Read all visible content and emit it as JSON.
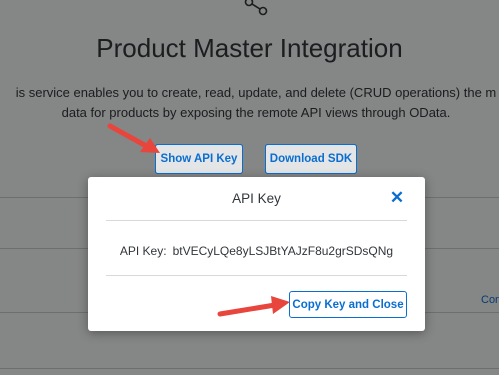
{
  "page": {
    "title": "Product Master Integration",
    "description_line1": "is service enables you to create, read, update, and delete (CRUD operations) the m",
    "description_line2": "data for products by exposing the remote API views through OData.",
    "show_api_key_label": "Show API Key",
    "download_sdk_label": "Download SDK",
    "right_link_partial": "Con"
  },
  "dialog": {
    "title": "API Key",
    "close_symbol": "✕",
    "key_label": "API Key:",
    "key_value": "btVECyLQe8yLSJBtYAJzF8u2grSDsQNg",
    "copy_button_label": "Copy Key and Close"
  },
  "colors": {
    "accent": "#0a6ed1",
    "arrow": "#e8453c"
  }
}
